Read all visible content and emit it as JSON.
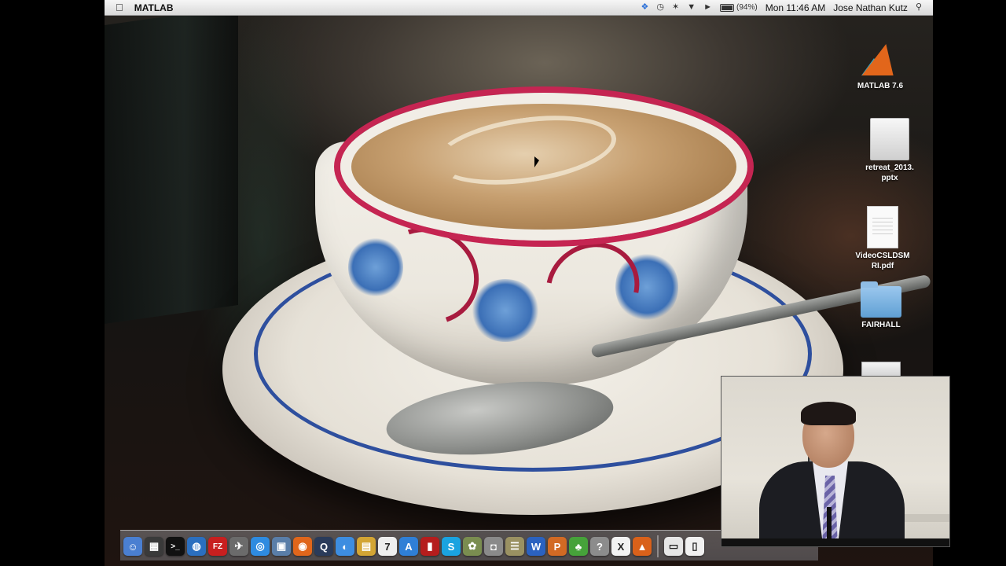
{
  "menubar": {
    "app_name": "MATLAB",
    "icons": [
      "apple-icon",
      "dropbox-icon",
      "time-machine-icon",
      "bluetooth-icon",
      "wifi-icon",
      "volume-icon",
      "battery-icon",
      "spotlight-icon"
    ],
    "battery_percent": "(94%)",
    "clock": "Mon 11:46 AM",
    "user": "Jose Nathan Kutz"
  },
  "desktop": {
    "icons": [
      {
        "label": "MATLAB 7.6"
      },
      {
        "label": "retreat_2013.\npptx"
      },
      {
        "label": "VideoCSLDSM\nRI.pdf"
      },
      {
        "label": "FAIRHALL"
      }
    ]
  },
  "dock": {
    "apps": [
      {
        "name": "finder-icon",
        "color": "#4a7fd1",
        "glyph": "☺"
      },
      {
        "name": "activity-monitor-icon",
        "color": "#3a3a3a",
        "glyph": "▦"
      },
      {
        "name": "terminal-icon",
        "color": "#111111",
        "glyph": ">_"
      },
      {
        "name": "network-globe-icon",
        "color": "#2b6fbf",
        "glyph": "◍"
      },
      {
        "name": "filezilla-icon",
        "color": "#c81f1f",
        "glyph": "FZ"
      },
      {
        "name": "launchpad-icon",
        "color": "#6b6b6b",
        "glyph": "✈"
      },
      {
        "name": "safari-icon",
        "color": "#2e8be0",
        "glyph": "◎"
      },
      {
        "name": "preview-icon",
        "color": "#5a7ea8",
        "glyph": "▣"
      },
      {
        "name": "firefox-icon",
        "color": "#e0661b",
        "glyph": "◉"
      },
      {
        "name": "quicktime-icon",
        "color": "#2a3b5a",
        "glyph": "Q"
      },
      {
        "name": "itunes-globe-icon",
        "color": "#3d8de0",
        "glyph": "◐"
      },
      {
        "name": "notes-icon",
        "color": "#d3a534",
        "glyph": "▤"
      },
      {
        "name": "calendar-icon",
        "color": "#eeeeee",
        "glyph": "7"
      },
      {
        "name": "app-store-icon",
        "color": "#2f7fd6",
        "glyph": "A"
      },
      {
        "name": "photo-booth-icon",
        "color": "#b51d1d",
        "glyph": "▮"
      },
      {
        "name": "skype-icon",
        "color": "#1aa3e0",
        "glyph": "S"
      },
      {
        "name": "iphoto-icon",
        "color": "#7a8d50",
        "glyph": "✿"
      },
      {
        "name": "camera-icon",
        "color": "#8a8a8a",
        "glyph": "◘"
      },
      {
        "name": "scroll-icon",
        "color": "#9a9162",
        "glyph": "☰"
      },
      {
        "name": "word-icon",
        "color": "#2b62c0",
        "glyph": "W"
      },
      {
        "name": "powerpoint-icon",
        "color": "#d26a24",
        "glyph": "P"
      },
      {
        "name": "chemistry-icon",
        "color": "#46a23a",
        "glyph": "♣"
      },
      {
        "name": "help-icon",
        "color": "#8c8c8c",
        "glyph": "?"
      },
      {
        "name": "x11-icon",
        "color": "#f2f2f2",
        "glyph": "X"
      },
      {
        "name": "matlab-dock-icon",
        "color": "#d9611a",
        "glyph": "▲"
      }
    ],
    "stacks": [
      {
        "name": "documents-stack-icon",
        "color": "#e6e6e6",
        "glyph": "▭"
      },
      {
        "name": "downloads-stack-icon",
        "color": "#f0f0f0",
        "glyph": "▯"
      }
    ]
  }
}
